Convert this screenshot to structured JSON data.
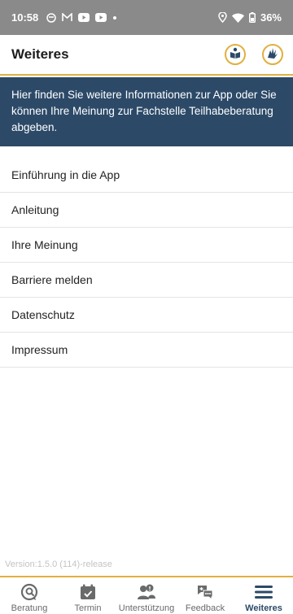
{
  "status_bar": {
    "time": "10:58",
    "battery": "36%",
    "icons": [
      "mask-icon",
      "gmail-icon",
      "youtube-icon",
      "youtube-icon",
      "dot-icon",
      "location-icon",
      "wifi-icon",
      "battery-icon"
    ]
  },
  "app_bar": {
    "title": "Weiteres",
    "actions": [
      "easy-language-icon",
      "sign-language-icon"
    ]
  },
  "banner": {
    "text": "Hier finden Sie weitere Informationen zur App oder Sie können Ihre Meinung zur Fachstelle Teilhabeberatung abgeben."
  },
  "menu": {
    "items": [
      {
        "label": "Einführung in die App"
      },
      {
        "label": "Anleitung"
      },
      {
        "label": "Ihre Meinung"
      },
      {
        "label": "Barriere melden"
      },
      {
        "label": "Datenschutz"
      },
      {
        "label": "Impressum"
      }
    ]
  },
  "version": "Version:1.5.0 (114)-release",
  "bottom_nav": {
    "items": [
      {
        "label": "Beratung",
        "icon": "search-chat-icon",
        "active": false
      },
      {
        "label": "Termin",
        "icon": "calendar-icon",
        "active": false
      },
      {
        "label": "Unterstützung",
        "icon": "people-icon",
        "active": false
      },
      {
        "label": "Feedback",
        "icon": "feedback-icon",
        "active": false
      },
      {
        "label": "Weiteres",
        "icon": "menu-icon",
        "active": true
      }
    ]
  },
  "colors": {
    "accent": "#e0b040",
    "banner": "#2c4a68",
    "status_bar": "#8a8a8a"
  }
}
